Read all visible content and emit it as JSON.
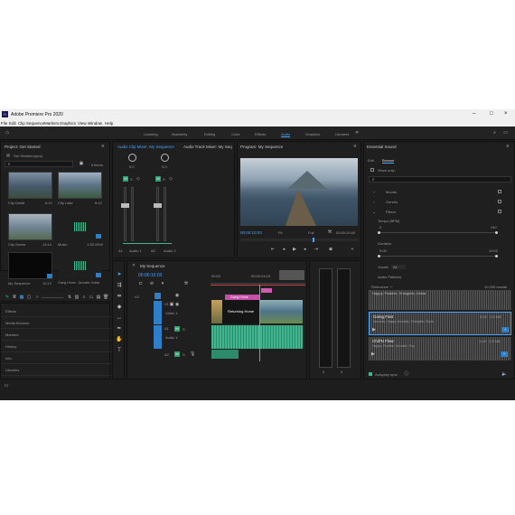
{
  "window": {
    "title": "Adobe Premiere Pro 2020"
  },
  "menu": [
    "File",
    "Edit",
    "Clip",
    "Sequence",
    "Markers",
    "Graphics",
    "View",
    "Window",
    "Help"
  ],
  "workspaces": [
    "Learning",
    "Assembly",
    "Editing",
    "Color",
    "Effects",
    "Audio",
    "Graphics",
    "Libraries"
  ],
  "active_workspace": "Audio",
  "project": {
    "title": "Project: Get Started",
    "file": "Get Started.prproj",
    "items_count": "6 items",
    "items": [
      {
        "name": "City Detail",
        "duration": "6:12"
      },
      {
        "name": "City Lake",
        "duration": "6:12"
      },
      {
        "name": "City Scene",
        "duration": "13:14"
      },
      {
        "name": "Music",
        "duration": "1:30:1009"
      },
      {
        "name": "My Sequence",
        "duration": "10:12"
      },
      {
        "name": "Going Home - Acoustic Guitar",
        "duration": "12:14"
      }
    ]
  },
  "effects_tabs": [
    "Effects",
    "Media Browser",
    "Markers",
    "History",
    "Info",
    "Libraries"
  ],
  "mixer": {
    "tab1": "Audio Clip Mixer: My Sequence",
    "tab2": "Audio Track Mixer: My Seq",
    "ch1": "A1",
    "ch1_name": "Audio 1",
    "ch2": "A2",
    "ch2_name": "Audio 2",
    "meter_value": "0.0"
  },
  "program": {
    "title": "Program: My Sequence",
    "timecode": "00:00:10:03",
    "fit": "Fit",
    "quality": "Full",
    "duration": "00:00:20:00"
  },
  "timeline": {
    "title": "My Sequence",
    "timecode": "00:00:10:03",
    "ruler": [
      "00:00",
      "00:00:04:23",
      "00:00:09:23"
    ],
    "tracks": [
      "V2",
      "V1",
      "A1",
      "A2"
    ],
    "v1_name": "Video 1",
    "a1_name": "Audio 1",
    "title_clip": "Going Home",
    "graphic_text": "Returning Home",
    "meter_scale": [
      "0",
      "0"
    ]
  },
  "essential_sound": {
    "title": "Essential Sound",
    "tabs": [
      "Edit",
      "Browse"
    ],
    "show_only": "Show only:",
    "search_placeholder": "",
    "filters": [
      "Moods",
      "Genres",
      "Filters"
    ],
    "tempo_label": "Tempo (BPM)",
    "tempo_min": "0",
    "tempo_max": "240",
    "duration_label": "Duration",
    "duration_min": "0:00",
    "duration_max": "10:00",
    "vocals_label": "Vocals",
    "vocals_value": "All",
    "audio_patterns": "Audio Patterns",
    "sort_label": "Relevance",
    "results_count": "10,000 results",
    "tracks": [
      {
        "title": "Happy, Positive, Energetic, Guitar",
        "meta": "",
        "time": "",
        "size": ""
      },
      {
        "title": "Going Fast",
        "meta": "Acoustic, Happy, Acoustic, Energetic, Rock",
        "time": "0:45",
        "size": "4.6 MB"
      },
      {
        "title": "Chill'N Flow",
        "meta": "Happy, Positive, Acoustic, Pop",
        "time": "1:48",
        "size": "3.8 MB"
      }
    ],
    "autoplay": "Autoplay sync"
  }
}
